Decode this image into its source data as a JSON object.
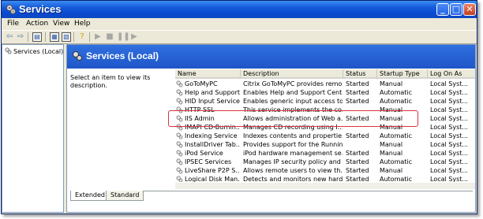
{
  "window": {
    "title": "Services",
    "controls": {
      "minimize": "_",
      "maximize": "□",
      "close": "✕"
    }
  },
  "menu": [
    "File",
    "Action",
    "View",
    "Help"
  ],
  "tree": {
    "root_label": "Services (Local)"
  },
  "panel": {
    "title": "Services (Local)",
    "description": "Select an item to view its description."
  },
  "table": {
    "columns": [
      "Name",
      "Description",
      "Status",
      "Startup Type",
      "Log On As"
    ],
    "rows": [
      {
        "name": "GoToMyPC",
        "description": "Citrix GoToMyPC provides remo...",
        "status": "Started",
        "startup": "Manual",
        "logon": "Local Syst..."
      },
      {
        "name": "Help and Support",
        "description": "Enables Help and Support Cent...",
        "status": "Started",
        "startup": "Automatic",
        "logon": "Local Syst..."
      },
      {
        "name": "HID Input Service",
        "description": "Enables generic input access to...",
        "status": "Started",
        "startup": "Automatic",
        "logon": "Local Syst..."
      },
      {
        "name": "HTTP SSL",
        "description": "This service implements the co...",
        "status": "",
        "startup": "Manual",
        "logon": "Local Syst..."
      },
      {
        "name": "IIS Admin",
        "description": "Allows administration of Web a...",
        "status": "Started",
        "startup": "Manual",
        "logon": "Local Syst..."
      },
      {
        "name": "IMAPI CD-Burnin...",
        "description": "Manages CD recording using I...",
        "status": "",
        "startup": "Manual",
        "logon": "Local Syst..."
      },
      {
        "name": "Indexing Service",
        "description": "Indexes contents and propertie...",
        "status": "Started",
        "startup": "Automatic",
        "logon": "Local Syst..."
      },
      {
        "name": "InstallDriver Tab...",
        "description": "Provides support for the Runnin...",
        "status": "",
        "startup": "Manual",
        "logon": "Local Syst..."
      },
      {
        "name": "iPod Service",
        "description": "iPod hardware management se...",
        "status": "Started",
        "startup": "Manual",
        "logon": "Local Syst..."
      },
      {
        "name": "IPSEC Services",
        "description": "Manages IP security policy and ...",
        "status": "Started",
        "startup": "Automatic",
        "logon": "Local Syst..."
      },
      {
        "name": "LiveShare P2P S...",
        "description": "Allows remote users to view th...",
        "status": "Started",
        "startup": "Manual",
        "logon": "Local Syst..."
      },
      {
        "name": "Logical Disk Man...",
        "description": "Detects and monitors new hard...",
        "status": "Started",
        "startup": "Automatic",
        "logon": "Local Syst..."
      }
    ]
  },
  "tabs": [
    "Extended",
    "Standard"
  ],
  "colors": {
    "titlebar": "#0a4ad0",
    "banner": "#2f6fe0",
    "highlight": "#d8353d",
    "chrome": "#ece9d8"
  }
}
